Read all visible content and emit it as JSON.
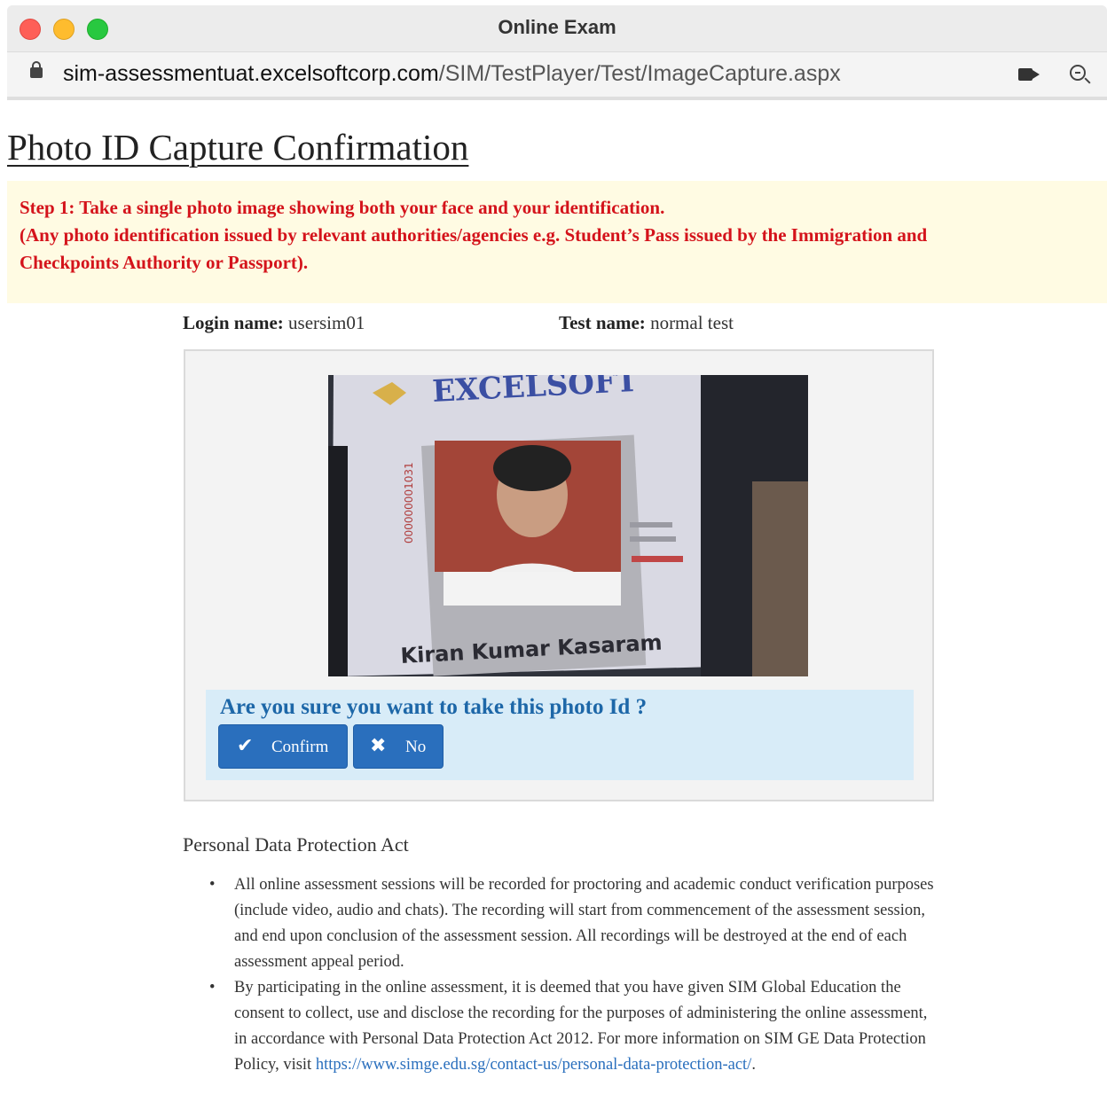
{
  "window": {
    "title": "Online Exam",
    "url_host": "sim-assessmentuat.excelsoftcorp.com",
    "url_path": "/SIM/TestPlayer/Test/ImageCapture.aspx"
  },
  "page": {
    "title": "Photo ID Capture Confirmation",
    "instructions": [
      "Step 1: Take a single photo image showing both your face and your identification.",
      "(Any photo identification issued by relevant authorities/agencies e.g. Student’s Pass issued by the Immigration and",
      "Checkpoints Authority or Passport)."
    ]
  },
  "meta": {
    "login_label": "Login name:",
    "login_value": "usersim01",
    "test_label": "Test name:",
    "test_value": "normal test"
  },
  "photo": {
    "card_brand": "EXCELSOFT",
    "card_name": "Kiran Kumar Kasaram",
    "card_number": "000000001031"
  },
  "confirm": {
    "question": "Are you sure you want to take this photo Id ?",
    "confirm_label": "Confirm",
    "no_label": "No",
    "confirm_icon": "check-icon",
    "no_icon": "close-icon"
  },
  "pdpa": {
    "title": "Personal Data Protection Act",
    "items": [
      "All online assessment sessions will be recorded for proctoring and academic conduct verification purposes (include video, audio and chats). The recording will start from commencement of the assessment session, and end upon conclusion of the assessment session. All recordings will be destroyed at the end of each assessment appeal period.",
      "By participating in the online assessment, it is deemed that you have given SIM Global Education the consent to collect, use and disclose the recording for the purposes of administering the online assessment, in accordance with Personal Data Protection Act 2012. For more information on SIM GE Data Protection Policy, visit"
    ],
    "link_text": "https://www.simge.edu.sg/contact-us/personal-data-protection-act/",
    "link_suffix": "."
  },
  "colors": {
    "instruction_text": "#d4131b",
    "instruction_bg": "#fffbe3",
    "button": "#2a6fbd",
    "confirm_bg": "#d8ecf8",
    "question_text": "#1d67a8"
  }
}
